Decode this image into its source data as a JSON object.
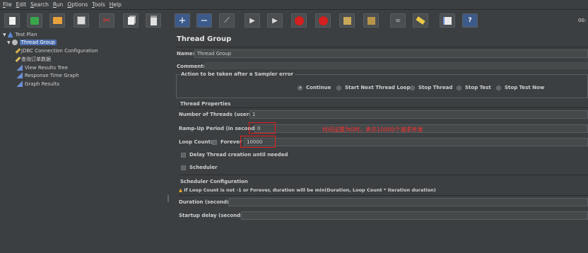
{
  "menu": [
    "File",
    "Edit",
    "Search",
    "Run",
    "Options",
    "Tools",
    "Help"
  ],
  "toolbar": {
    "right_text": "00:",
    "buttons": [
      "new-icon",
      "templates-icon",
      "open-icon",
      "save-icon",
      "cut-icon",
      "copy-icon",
      "paste-icon",
      "expand-icon",
      "collapse-icon",
      "toggle-icon",
      "start-icon",
      "start-no-pause-icon",
      "stop-icon",
      "shutdown-icon",
      "clear-icon",
      "clear-all-icon",
      "search-icon",
      "reset-search-icon",
      "function-helper-icon",
      "help-icon"
    ]
  },
  "tree": {
    "items": [
      {
        "label": "Test Plan"
      },
      {
        "label": "Thread Group"
      },
      {
        "label": "JDBC Connection Configuration"
      },
      {
        "label": "查询订单数据"
      },
      {
        "label": "View Results Tree"
      },
      {
        "label": "Response Time Graph"
      },
      {
        "label": "Graph Results"
      }
    ]
  },
  "panel": {
    "title": "Thread Group",
    "name_label": "Name:",
    "name_value": "Thread Group",
    "comments_label": "Comments:",
    "error_group_title": "Action to be taken after a Sampler error",
    "error_options": [
      "Continue",
      "Start Next Thread Loop",
      "Stop Thread",
      "Stop Test",
      "Stop Test Now"
    ],
    "thread_props_title": "Thread Properties",
    "threads_label": "Number of Threads (users):",
    "threads_value": "1",
    "rampup_label": "Ramp-Up Period (in seconds):",
    "rampup_value": "0",
    "loop_label": "Loop Count:",
    "forever_label": "Forever",
    "loop_value": "10000",
    "delay_label": "Delay Thread creation until needed",
    "scheduler_label": "Scheduler",
    "sched_config_title": "Scheduler Configuration",
    "sched_warning": "If Loop Count is not -1 or Forever, duration will be min(Duration, Loop Count * iteration duration)",
    "duration_label": "Duration (seconds)",
    "startup_label": "Startup delay (seconds)",
    "annotation": "时间设置为0时，表示10000个请求并发"
  },
  "colors": {
    "selection": "#4b6eaf",
    "annotation": "#e02020"
  }
}
